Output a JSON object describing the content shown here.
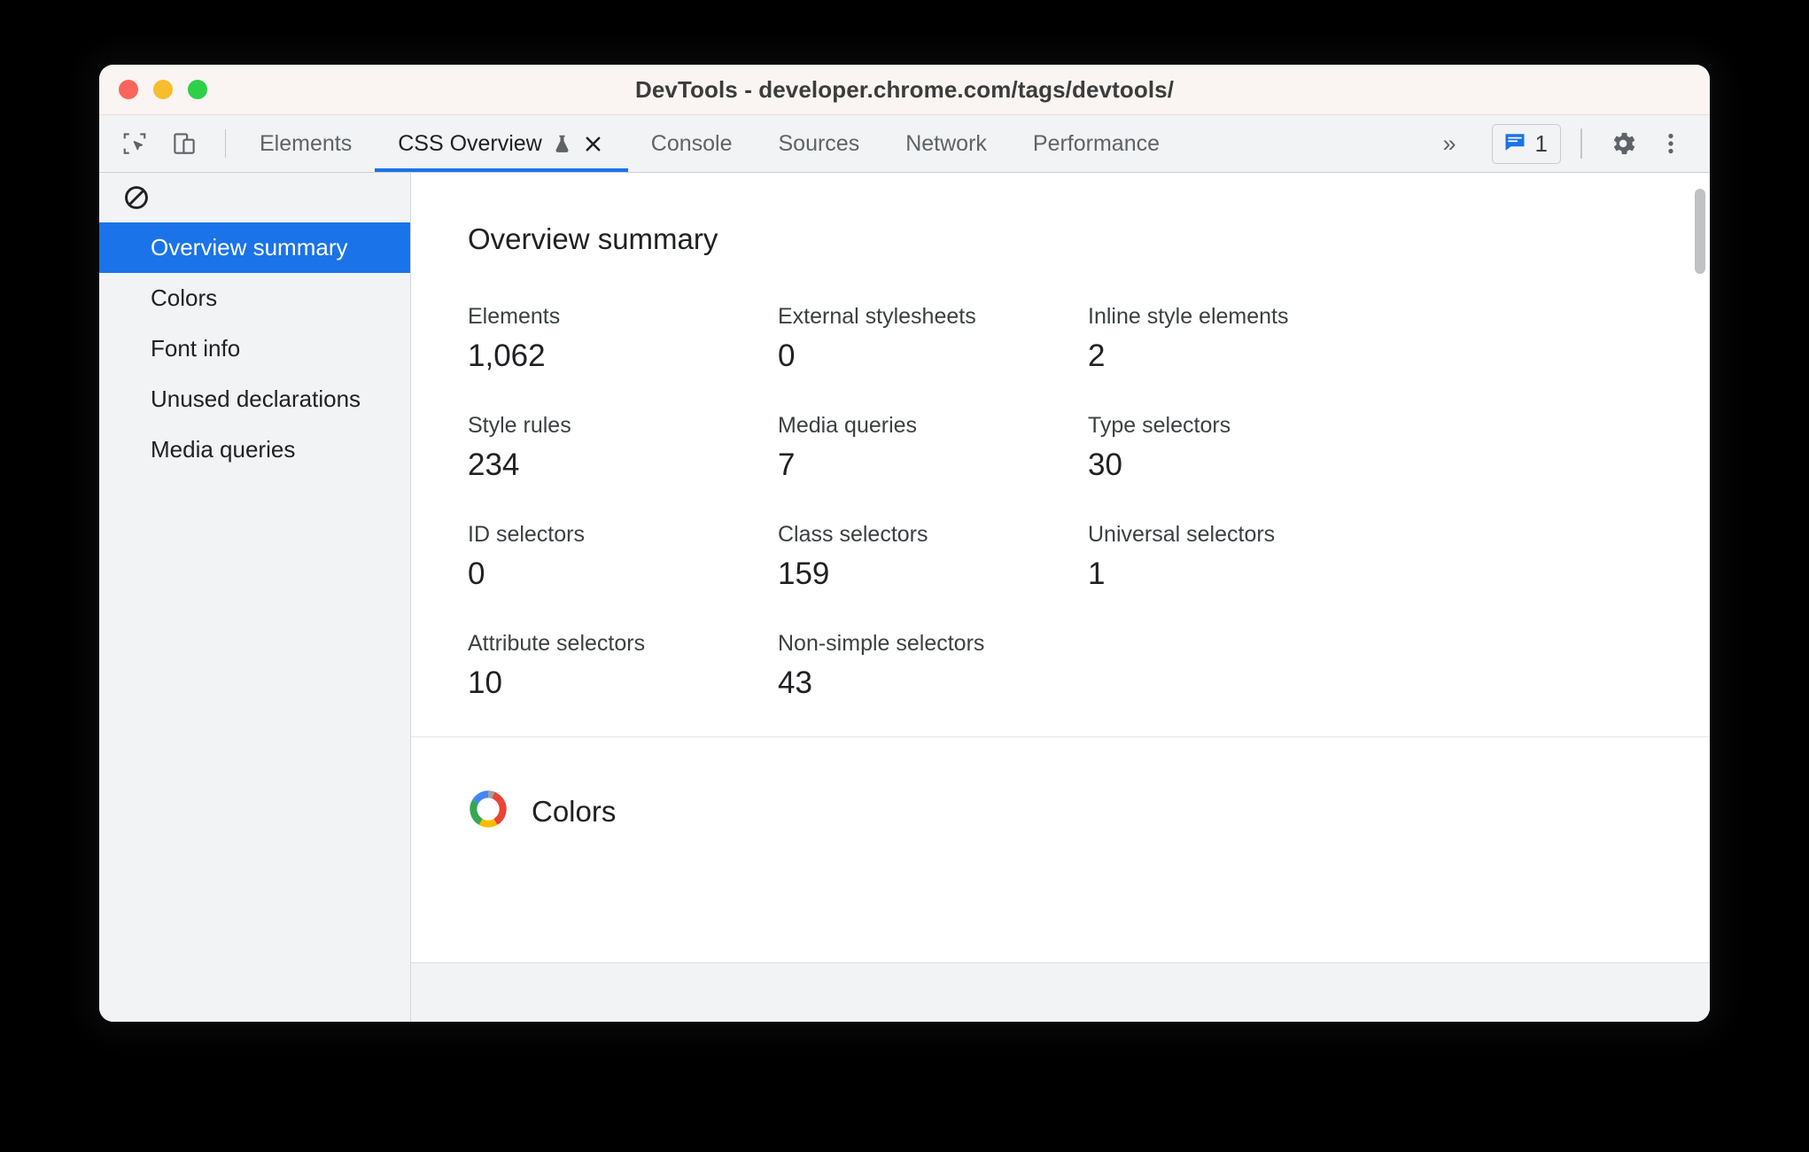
{
  "window": {
    "title": "DevTools - developer.chrome.com/tags/devtools/",
    "traffic_lights": [
      "close",
      "minimize",
      "zoom"
    ],
    "accent_blue": "#1a73e8",
    "titlebar_bg": "#faf4f2"
  },
  "tabbar": {
    "left_icons": [
      {
        "name": "inspect-element-icon"
      },
      {
        "name": "device-toolbar-icon"
      }
    ],
    "tabs": [
      {
        "label": "Elements",
        "active": false,
        "has_flask": false,
        "closable": false
      },
      {
        "label": "CSS Overview",
        "active": true,
        "has_flask": true,
        "closable": true
      },
      {
        "label": "Console",
        "active": false,
        "has_flask": false,
        "closable": false
      },
      {
        "label": "Sources",
        "active": false,
        "has_flask": false,
        "closable": false
      },
      {
        "label": "Network",
        "active": false,
        "has_flask": false,
        "closable": false
      },
      {
        "label": "Performance",
        "active": false,
        "has_flask": false,
        "closable": false
      }
    ],
    "more_tabs_label": "»",
    "message_count": "1",
    "message_icon": "console-message-icon",
    "settings_icon": "gear-icon",
    "overflow_icon": "kebab-menu-icon"
  },
  "sidebar": {
    "toolbar": {
      "clear_icon": "clear-block-icon"
    },
    "items": [
      {
        "label": "Overview summary",
        "selected": true
      },
      {
        "label": "Colors",
        "selected": false
      },
      {
        "label": "Font info",
        "selected": false
      },
      {
        "label": "Unused declarations",
        "selected": false
      },
      {
        "label": "Media queries",
        "selected": false
      }
    ]
  },
  "main": {
    "summary": {
      "title": "Overview summary",
      "stats": [
        {
          "label": "Elements",
          "value": "1,062"
        },
        {
          "label": "External stylesheets",
          "value": "0"
        },
        {
          "label": "Inline style elements",
          "value": "2"
        },
        {
          "label": "Style rules",
          "value": "234"
        },
        {
          "label": "Media queries",
          "value": "7"
        },
        {
          "label": "Type selectors",
          "value": "30"
        },
        {
          "label": "ID selectors",
          "value": "0"
        },
        {
          "label": "Class selectors",
          "value": "159"
        },
        {
          "label": "Universal selectors",
          "value": "1"
        },
        {
          "label": "Attribute selectors",
          "value": "10"
        },
        {
          "label": "Non-simple selectors",
          "value": "43"
        }
      ]
    },
    "colors_section": {
      "title": "Colors",
      "icon": "color-wheel-icon",
      "wheel_colors": [
        "#ea4335",
        "#fbbc04",
        "#34a853",
        "#4285f4",
        "#9aa0a6"
      ]
    }
  }
}
